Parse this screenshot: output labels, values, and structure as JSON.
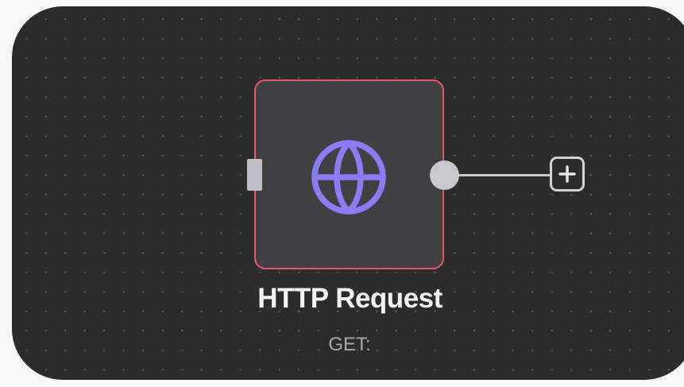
{
  "node": {
    "title": "HTTP Request",
    "subtitle": "GET:",
    "icon": "globe-icon",
    "border_color": "#e8566a",
    "icon_color": "#8b7cf6"
  },
  "add_button": {
    "icon": "plus-icon"
  },
  "colors": {
    "canvas_background": "#2c2c2c",
    "node_background": "#404043",
    "connector": "#c7c9ce"
  }
}
